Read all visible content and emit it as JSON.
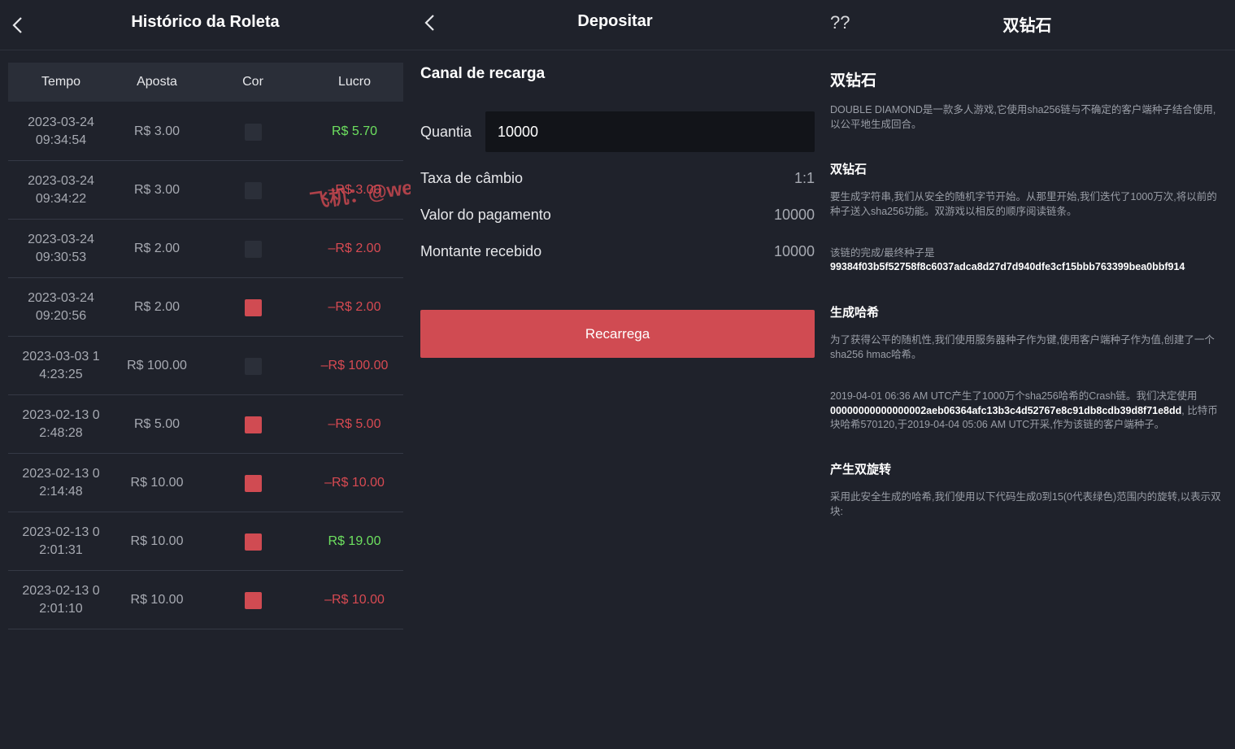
{
  "history": {
    "title": "Histórico da Roleta",
    "columns": [
      "Tempo",
      "Aposta",
      "Cor",
      "Lucro"
    ],
    "rows": [
      {
        "time1": "2023-03-24",
        "time2": "09:34:54",
        "bet": "R$ 3.00",
        "color": "#2b2f39",
        "profit": "R$ 5.70",
        "type": "pos"
      },
      {
        "time1": "2023-03-24",
        "time2": "09:34:22",
        "bet": "R$ 3.00",
        "color": "#2b2f39",
        "profit": "–R$ 3.00",
        "type": "neg"
      },
      {
        "time1": "2023-03-24",
        "time2": "09:30:53",
        "bet": "R$ 2.00",
        "color": "#2b2f39",
        "profit": "–R$ 2.00",
        "type": "neg"
      },
      {
        "time1": "2023-03-24",
        "time2": "09:20:56",
        "bet": "R$ 2.00",
        "color": "#d04b52",
        "profit": "–R$ 2.00",
        "type": "neg"
      },
      {
        "time1": "2023-03-03 1",
        "time2": "4:23:25",
        "bet": "R$ 100.00",
        "color": "#2b2f39",
        "profit": "–R$ 100.00",
        "type": "neg"
      },
      {
        "time1": "2023-02-13 0",
        "time2": "2:48:28",
        "bet": "R$ 5.00",
        "color": "#d04b52",
        "profit": "–R$ 5.00",
        "type": "neg"
      },
      {
        "time1": "2023-02-13 0",
        "time2": "2:14:48",
        "bet": "R$ 10.00",
        "color": "#d04b52",
        "profit": "–R$ 10.00",
        "type": "neg"
      },
      {
        "time1": "2023-02-13 0",
        "time2": "2:01:31",
        "bet": "R$ 10.00",
        "color": "#d04b52",
        "profit": "R$ 19.00",
        "type": "pos"
      },
      {
        "time1": "2023-02-13 0",
        "time2": "2:01:10",
        "bet": "R$ 10.00",
        "color": "#d04b52",
        "profit": "–R$ 10.00",
        "type": "neg"
      }
    ],
    "watermark": "飞机：@wetuni"
  },
  "deposit": {
    "title": "Depositar",
    "section": "Canal de recarga",
    "quantity_label": "Quantia",
    "quantity_value": "10000",
    "rate_label": "Taxa de câmbio",
    "rate_value": "1:1",
    "payment_label": "Valor do pagamento",
    "payment_value": "10000",
    "received_label": "Montante recebido",
    "received_value": "10000",
    "button": "Recarrega"
  },
  "info": {
    "corner": "??",
    "title": "双钻石",
    "heading": "双钻石",
    "intro": "DOUBLE DIAMOND是一款多人游戏,它使用sha256链与不确定的客户端种子结合使用,以公平地生成回合。",
    "s1_title": "双钻石",
    "s1_text": "要生成字符串,我们从安全的随机字节开始。从那里开始,我们迭代了1000万次,将以前的种子送入sha256功能。双游戏以相反的顺序阅读链条。",
    "s1_note": "该链的完成/最终种子是",
    "s1_hash": "99384f03b5f52758f8c6037adca8d27d7d940dfe3cf15bbb763399bea0bbf914",
    "s2_title": "生成哈希",
    "s2_text": "为了获得公平的随机性,我们使用服务器种子作为键,使用客户端种子作为值,创建了一个sha256 hmac哈希。",
    "s2_pre": "2019-04-01 06:36 AM UTC产生了1000万个sha256哈希的Crash链。我们决定使用",
    "s2_hash": "00000000000000002aeb06364afc13b3c4d52767e8c91db8cdb39d8f71e8dd",
    "s2_post": ", 比特币块哈希570120,于2019-04-04 05:06 AM UTC开采,作为该链的客户端种子。",
    "s3_title": "产生双旋转",
    "s3_text": "采用此安全生成的哈希,我们使用以下代码生成0到15(0代表绿色)范围内的旋转,以表示双块:"
  }
}
